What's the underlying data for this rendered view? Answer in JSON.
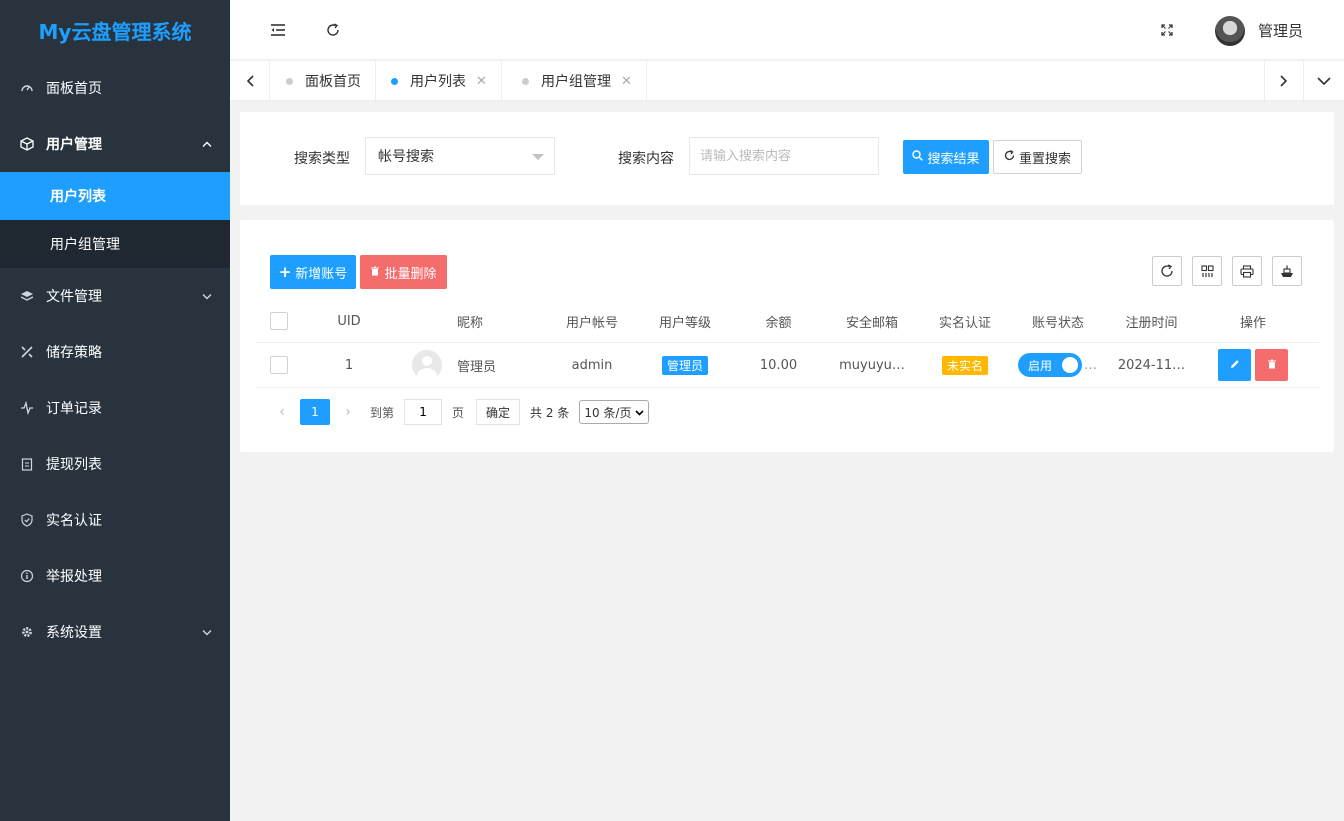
{
  "app": {
    "title": "My云盘管理系统",
    "user_name": "管理员"
  },
  "sidebar": {
    "items": [
      {
        "label": "面板首页",
        "icon": "dashboard-icon"
      },
      {
        "label": "用户管理",
        "icon": "cube-icon",
        "expanded": true,
        "children": [
          {
            "label": "用户列表",
            "active": true
          },
          {
            "label": "用户组管理"
          }
        ]
      },
      {
        "label": "文件管理",
        "icon": "layers-icon"
      },
      {
        "label": "储存策略",
        "icon": "tools-icon"
      },
      {
        "label": "订单记录",
        "icon": "pulse-icon"
      },
      {
        "label": "提现列表",
        "icon": "clipboard-icon"
      },
      {
        "label": "实名认证",
        "icon": "shield-icon"
      },
      {
        "label": "举报处理",
        "icon": "info-icon"
      },
      {
        "label": "系统设置",
        "icon": "gear-icon"
      }
    ]
  },
  "tabs": [
    {
      "label": "面板首页",
      "active": false,
      "closable": false
    },
    {
      "label": "用户列表",
      "active": true,
      "closable": true
    },
    {
      "label": "用户组管理",
      "active": false,
      "closable": true
    }
  ],
  "search": {
    "type_label": "搜索类型",
    "type_value": "帐号搜索",
    "content_label": "搜索内容",
    "content_placeholder": "请输入搜索内容",
    "search_button": "搜索结果",
    "reset_button": "重置搜索"
  },
  "toolbar": {
    "add_button": "新增账号",
    "batch_delete_button": "批量删除"
  },
  "table": {
    "headers": [
      "UID",
      "昵称",
      "用户帐号",
      "用户等级",
      "余额",
      "安全邮箱",
      "实名认证",
      "账号状态",
      "注册时间",
      "操作"
    ],
    "rows": [
      {
        "uid": "1",
        "nickname": "管理员",
        "account": "admin",
        "level": "管理员",
        "balance": "10.00",
        "email": "muyuyu…",
        "realname": "未实名",
        "status": "启用",
        "registered": "2024-11…"
      }
    ]
  },
  "pagination": {
    "current_page": "1",
    "goto_prefix": "到第",
    "goto_value": "1",
    "goto_suffix": "页",
    "confirm": "确定",
    "total": "共 2 条",
    "page_size": "10 条/页"
  },
  "colors": {
    "primary": "#1e9fff",
    "danger": "#f56c6c",
    "warning": "#ffb800",
    "sidebar_bg": "#28333e"
  }
}
